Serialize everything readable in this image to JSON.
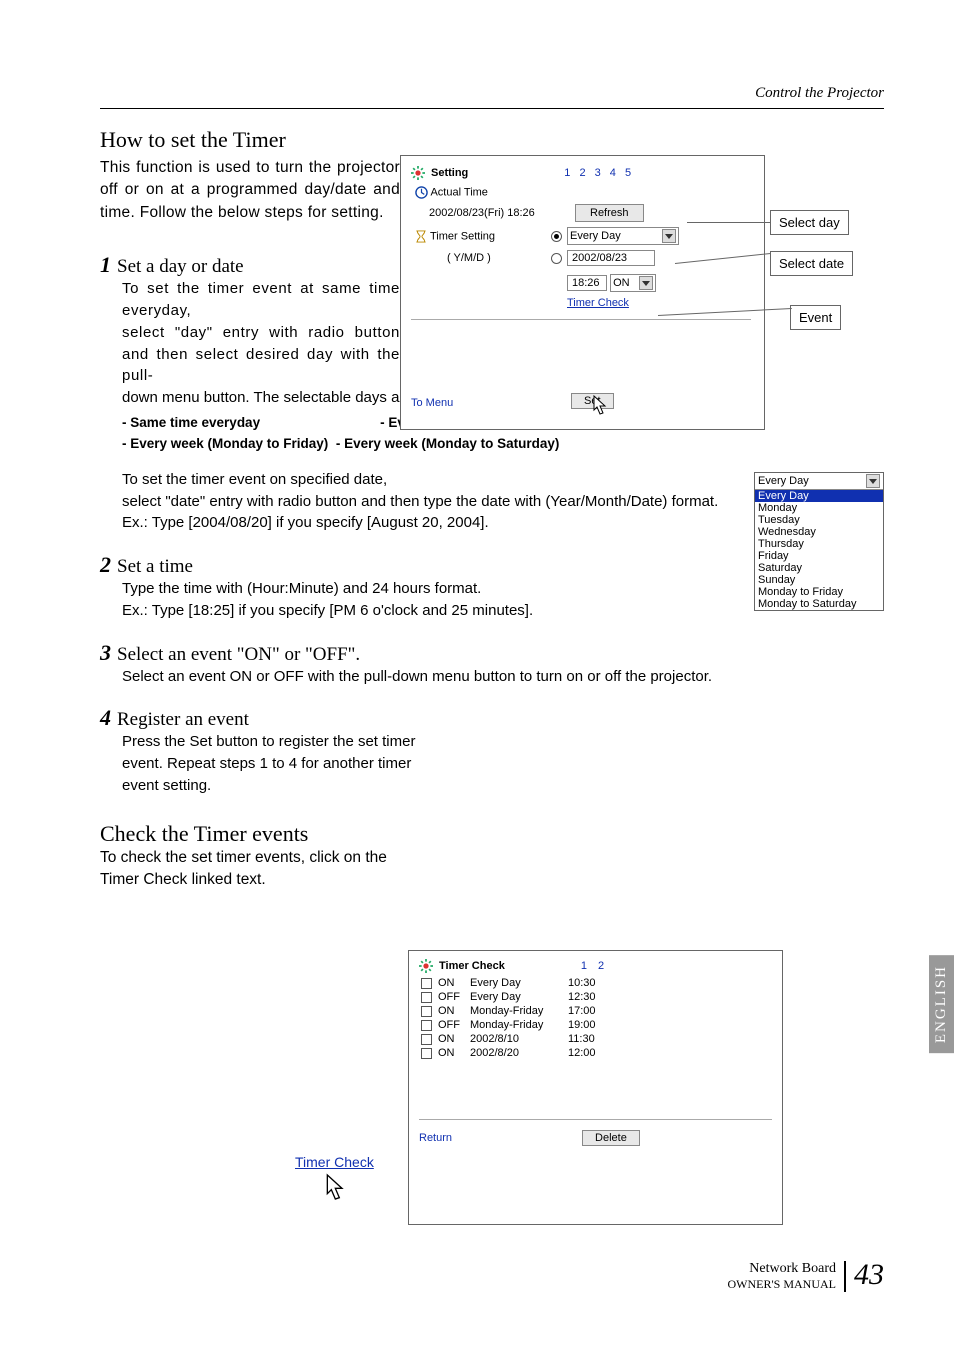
{
  "header": {
    "section_label": "Control the Projector"
  },
  "title_how_to_set": "How to set the Timer",
  "intro": "This function is used to turn the projector off or on at a programmed day/date and time. Follow the below steps for setting.",
  "fig_setting": {
    "title": "Setting",
    "pages": "1 2 3 4 5",
    "actual_time_label": "Actual Time",
    "actual_time_value": "2002/08/23(Fri) 18:26",
    "refresh": "Refresh",
    "timer_setting_label": "Timer Setting",
    "ymd_label": "( Y/M/D )",
    "day_select_value": "Every Day",
    "date_input_value": "2002/08/23",
    "time_input_value": "18:26",
    "event_select_value": "ON",
    "timer_check_link": "Timer Check",
    "to_menu": "To Menu",
    "set": "Set"
  },
  "callouts": {
    "select_day": "Select day",
    "select_date": "Select date",
    "event": "Event"
  },
  "step1": {
    "title": "Set a day or date",
    "sub1": "To set the timer event at same time everyday,",
    "body1a": "select \"day\" entry with radio button and then select desired day with the pull-",
    "body1b": "down menu button. The selectable days are as follows:",
    "dash1": "- Same time everyday",
    "dash2": "- Every week ( a day from Monday to Sunday)",
    "dash3": "- Every week (Monday to Friday)",
    "dash4": "- Every week (Monday to Saturday)",
    "sub2": "To set the timer event on specified date,",
    "body2": "select \"date\" entry with radio button and then type the date with (Year/Month/Date) format.",
    "ex1": "Ex.: Type [2004/08/20] if you specify [August 20, 2004]."
  },
  "days_list": {
    "head": "Every Day",
    "selected": "Every Day",
    "opts": [
      "Monday",
      "Tuesday",
      "Wednesday",
      "Thursday",
      "Friday",
      "Saturday",
      "Sunday",
      "Monday to Friday",
      "Monday to Saturday"
    ]
  },
  "step2": {
    "title": "Set a time",
    "body": "Type the time with (Hour:Minute) and 24 hours format.",
    "ex": "Ex.: Type [18:25] if you specify [PM 6 o'clock and 25 minutes]."
  },
  "step3": {
    "title": "Select an event \"ON\" or \"OFF\".",
    "body": "Select an event ON or OFF with the pull-down menu button to turn on or off the projector."
  },
  "step4": {
    "title": "Register an event",
    "body": "Press the Set button to register the set timer event. Repeat steps 1 to 4 for another timer event setting."
  },
  "title_check": "Check the Timer events",
  "check_body": "To check the set timer events, click on the Timer Check linked text.",
  "timer_check_cursor_label": "Timer Check",
  "fig_check": {
    "title": "Timer Check",
    "pages": "1 2",
    "rows": [
      {
        "state": "ON",
        "day": "Every Day",
        "time": "10:30"
      },
      {
        "state": "OFF",
        "day": "Every Day",
        "time": "12:30"
      },
      {
        "state": "ON",
        "day": "Monday-Friday",
        "time": "17:00"
      },
      {
        "state": "OFF",
        "day": "Monday-Friday",
        "time": "19:00"
      },
      {
        "state": "ON",
        "day": "2002/8/10",
        "time": "11:30"
      },
      {
        "state": "ON",
        "day": "2002/8/20",
        "time": "12:00"
      }
    ],
    "return": "Return",
    "delete": "Delete"
  },
  "english_tab": "ENGLISH",
  "footer": {
    "line1": "Network Board",
    "line2": "OWNER'S MANUAL",
    "page": "43"
  }
}
